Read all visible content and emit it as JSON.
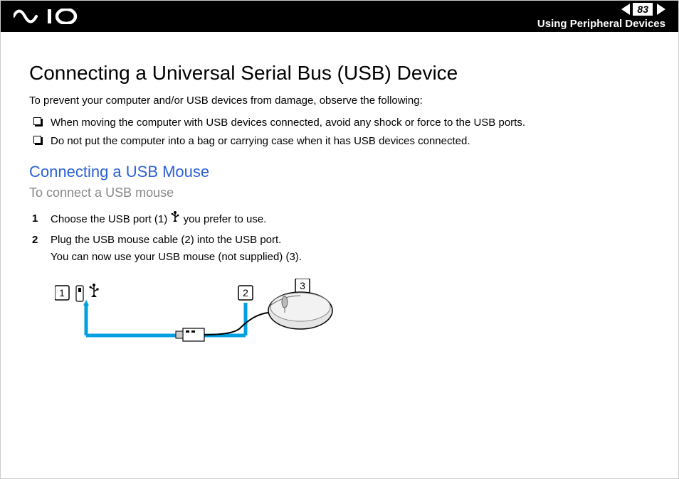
{
  "header": {
    "page_number": "83",
    "breadcrumb": "Using Peripheral Devices"
  },
  "title": "Connecting a Universal Serial Bus (USB) Device",
  "intro": "To prevent your computer and/or USB devices from damage, observe the following:",
  "bullets": [
    "When moving the computer with USB devices connected, avoid any shock or force to the USB ports.",
    "Do not put the computer into a bag or carrying case when it has USB devices connected."
  ],
  "section_title": "Connecting a USB Mouse",
  "section_subhead": "To connect a USB mouse",
  "steps": [
    {
      "n": "1",
      "text_before": "Choose the USB port (1) ",
      "text_after": " you prefer to use."
    },
    {
      "n": "2",
      "text_before": "Plug the USB mouse cable (2) into the USB port.",
      "text_after": "",
      "line2": "You can now use your USB mouse (not supplied) (3)."
    }
  ],
  "diagram": {
    "labels": {
      "1": "1",
      "2": "2",
      "3": "3"
    }
  }
}
